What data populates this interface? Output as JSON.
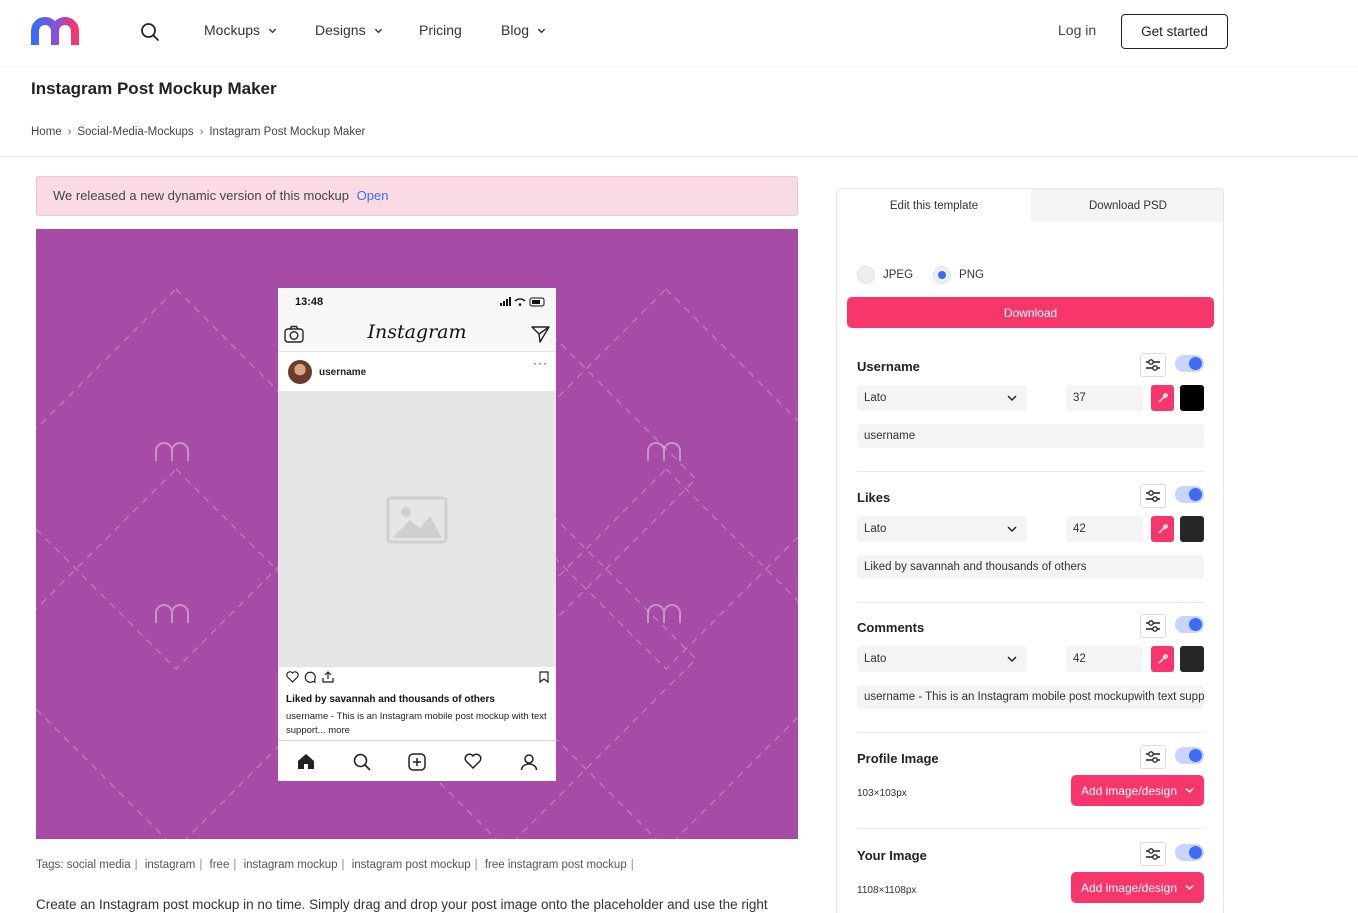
{
  "nav": {
    "items": [
      {
        "label": "Mockups",
        "dropdown": true
      },
      {
        "label": "Designs",
        "dropdown": true
      },
      {
        "label": "Pricing",
        "dropdown": false
      },
      {
        "label": "Blog",
        "dropdown": true
      }
    ],
    "login": "Log in",
    "cta": "Get started"
  },
  "page": {
    "title": "Instagram Post Mockup Maker",
    "breadcrumb": [
      "Home",
      "Social-Media-Mockups",
      "Instagram Post Mockup Maker"
    ]
  },
  "notice": {
    "text": "We released a new dynamic version of this mockup",
    "link": "Open"
  },
  "preview": {
    "bg_color": "#a64ca6",
    "phone": {
      "time": "13:48",
      "app_name": "Instagram",
      "username": "username",
      "likes": "Liked by savannah and thousands of others",
      "caption": "username - This is an Instagram mobile post mockup with text support... more"
    }
  },
  "tags": {
    "label": "Tags:",
    "items": [
      "social media",
      "instagram",
      "free",
      "instagram mockup",
      "instagram post mockup",
      "free instagram post mockup"
    ]
  },
  "description": "Create an Instagram post mockup in no time. Simply drag and drop your post image onto the placeholder and use the right",
  "panel": {
    "tabs": [
      "Edit this template",
      "Download PSD"
    ],
    "formats": [
      {
        "label": "JPEG",
        "selected": false
      },
      {
        "label": "PNG",
        "selected": true
      }
    ],
    "download": "Download",
    "accent": "#f7366c",
    "sections": {
      "username": {
        "title": "Username",
        "font": "Lato",
        "size": "37",
        "color": "#000000",
        "text": "username"
      },
      "likes": {
        "title": "Likes",
        "font": "Lato",
        "size": "42",
        "color": "#262626",
        "text": "Liked by savannah and thousands of others"
      },
      "comments": {
        "title": "Comments",
        "font": "Lato",
        "size": "42",
        "color": "#262626",
        "text": "username - This is an Instagram mobile post mockupwith text support"
      },
      "profile_image": {
        "title": "Profile Image",
        "dims": "103×103px",
        "button": "Add image/design"
      },
      "your_image": {
        "title": "Your Image",
        "dims": "1108×1108px",
        "button": "Add image/design"
      }
    }
  }
}
